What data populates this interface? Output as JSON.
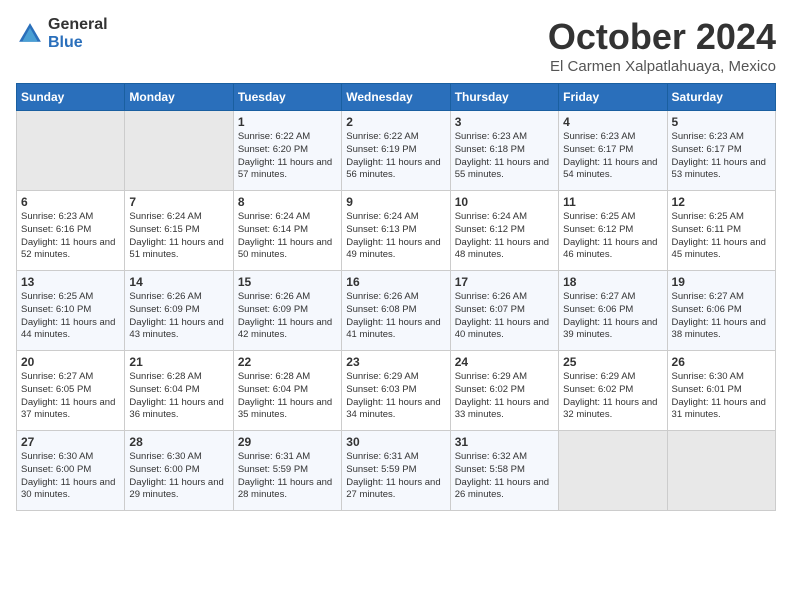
{
  "logo": {
    "general": "General",
    "blue": "Blue"
  },
  "title": "October 2024",
  "location": "El Carmen Xalpatlahuaya, Mexico",
  "days_header": [
    "Sunday",
    "Monday",
    "Tuesday",
    "Wednesday",
    "Thursday",
    "Friday",
    "Saturday"
  ],
  "weeks": [
    [
      {
        "day": "",
        "sunrise": "",
        "sunset": "",
        "daylight": ""
      },
      {
        "day": "",
        "sunrise": "",
        "sunset": "",
        "daylight": ""
      },
      {
        "day": "1",
        "sunrise": "Sunrise: 6:22 AM",
        "sunset": "Sunset: 6:20 PM",
        "daylight": "Daylight: 11 hours and 57 minutes."
      },
      {
        "day": "2",
        "sunrise": "Sunrise: 6:22 AM",
        "sunset": "Sunset: 6:19 PM",
        "daylight": "Daylight: 11 hours and 56 minutes."
      },
      {
        "day": "3",
        "sunrise": "Sunrise: 6:23 AM",
        "sunset": "Sunset: 6:18 PM",
        "daylight": "Daylight: 11 hours and 55 minutes."
      },
      {
        "day": "4",
        "sunrise": "Sunrise: 6:23 AM",
        "sunset": "Sunset: 6:17 PM",
        "daylight": "Daylight: 11 hours and 54 minutes."
      },
      {
        "day": "5",
        "sunrise": "Sunrise: 6:23 AM",
        "sunset": "Sunset: 6:17 PM",
        "daylight": "Daylight: 11 hours and 53 minutes."
      }
    ],
    [
      {
        "day": "6",
        "sunrise": "Sunrise: 6:23 AM",
        "sunset": "Sunset: 6:16 PM",
        "daylight": "Daylight: 11 hours and 52 minutes."
      },
      {
        "day": "7",
        "sunrise": "Sunrise: 6:24 AM",
        "sunset": "Sunset: 6:15 PM",
        "daylight": "Daylight: 11 hours and 51 minutes."
      },
      {
        "day": "8",
        "sunrise": "Sunrise: 6:24 AM",
        "sunset": "Sunset: 6:14 PM",
        "daylight": "Daylight: 11 hours and 50 minutes."
      },
      {
        "day": "9",
        "sunrise": "Sunrise: 6:24 AM",
        "sunset": "Sunset: 6:13 PM",
        "daylight": "Daylight: 11 hours and 49 minutes."
      },
      {
        "day": "10",
        "sunrise": "Sunrise: 6:24 AM",
        "sunset": "Sunset: 6:12 PM",
        "daylight": "Daylight: 11 hours and 48 minutes."
      },
      {
        "day": "11",
        "sunrise": "Sunrise: 6:25 AM",
        "sunset": "Sunset: 6:12 PM",
        "daylight": "Daylight: 11 hours and 46 minutes."
      },
      {
        "day": "12",
        "sunrise": "Sunrise: 6:25 AM",
        "sunset": "Sunset: 6:11 PM",
        "daylight": "Daylight: 11 hours and 45 minutes."
      }
    ],
    [
      {
        "day": "13",
        "sunrise": "Sunrise: 6:25 AM",
        "sunset": "Sunset: 6:10 PM",
        "daylight": "Daylight: 11 hours and 44 minutes."
      },
      {
        "day": "14",
        "sunrise": "Sunrise: 6:26 AM",
        "sunset": "Sunset: 6:09 PM",
        "daylight": "Daylight: 11 hours and 43 minutes."
      },
      {
        "day": "15",
        "sunrise": "Sunrise: 6:26 AM",
        "sunset": "Sunset: 6:09 PM",
        "daylight": "Daylight: 11 hours and 42 minutes."
      },
      {
        "day": "16",
        "sunrise": "Sunrise: 6:26 AM",
        "sunset": "Sunset: 6:08 PM",
        "daylight": "Daylight: 11 hours and 41 minutes."
      },
      {
        "day": "17",
        "sunrise": "Sunrise: 6:26 AM",
        "sunset": "Sunset: 6:07 PM",
        "daylight": "Daylight: 11 hours and 40 minutes."
      },
      {
        "day": "18",
        "sunrise": "Sunrise: 6:27 AM",
        "sunset": "Sunset: 6:06 PM",
        "daylight": "Daylight: 11 hours and 39 minutes."
      },
      {
        "day": "19",
        "sunrise": "Sunrise: 6:27 AM",
        "sunset": "Sunset: 6:06 PM",
        "daylight": "Daylight: 11 hours and 38 minutes."
      }
    ],
    [
      {
        "day": "20",
        "sunrise": "Sunrise: 6:27 AM",
        "sunset": "Sunset: 6:05 PM",
        "daylight": "Daylight: 11 hours and 37 minutes."
      },
      {
        "day": "21",
        "sunrise": "Sunrise: 6:28 AM",
        "sunset": "Sunset: 6:04 PM",
        "daylight": "Daylight: 11 hours and 36 minutes."
      },
      {
        "day": "22",
        "sunrise": "Sunrise: 6:28 AM",
        "sunset": "Sunset: 6:04 PM",
        "daylight": "Daylight: 11 hours and 35 minutes."
      },
      {
        "day": "23",
        "sunrise": "Sunrise: 6:29 AM",
        "sunset": "Sunset: 6:03 PM",
        "daylight": "Daylight: 11 hours and 34 minutes."
      },
      {
        "day": "24",
        "sunrise": "Sunrise: 6:29 AM",
        "sunset": "Sunset: 6:02 PM",
        "daylight": "Daylight: 11 hours and 33 minutes."
      },
      {
        "day": "25",
        "sunrise": "Sunrise: 6:29 AM",
        "sunset": "Sunset: 6:02 PM",
        "daylight": "Daylight: 11 hours and 32 minutes."
      },
      {
        "day": "26",
        "sunrise": "Sunrise: 6:30 AM",
        "sunset": "Sunset: 6:01 PM",
        "daylight": "Daylight: 11 hours and 31 minutes."
      }
    ],
    [
      {
        "day": "27",
        "sunrise": "Sunrise: 6:30 AM",
        "sunset": "Sunset: 6:00 PM",
        "daylight": "Daylight: 11 hours and 30 minutes."
      },
      {
        "day": "28",
        "sunrise": "Sunrise: 6:30 AM",
        "sunset": "Sunset: 6:00 PM",
        "daylight": "Daylight: 11 hours and 29 minutes."
      },
      {
        "day": "29",
        "sunrise": "Sunrise: 6:31 AM",
        "sunset": "Sunset: 5:59 PM",
        "daylight": "Daylight: 11 hours and 28 minutes."
      },
      {
        "day": "30",
        "sunrise": "Sunrise: 6:31 AM",
        "sunset": "Sunset: 5:59 PM",
        "daylight": "Daylight: 11 hours and 27 minutes."
      },
      {
        "day": "31",
        "sunrise": "Sunrise: 6:32 AM",
        "sunset": "Sunset: 5:58 PM",
        "daylight": "Daylight: 11 hours and 26 minutes."
      },
      {
        "day": "",
        "sunrise": "",
        "sunset": "",
        "daylight": ""
      },
      {
        "day": "",
        "sunrise": "",
        "sunset": "",
        "daylight": ""
      }
    ]
  ]
}
